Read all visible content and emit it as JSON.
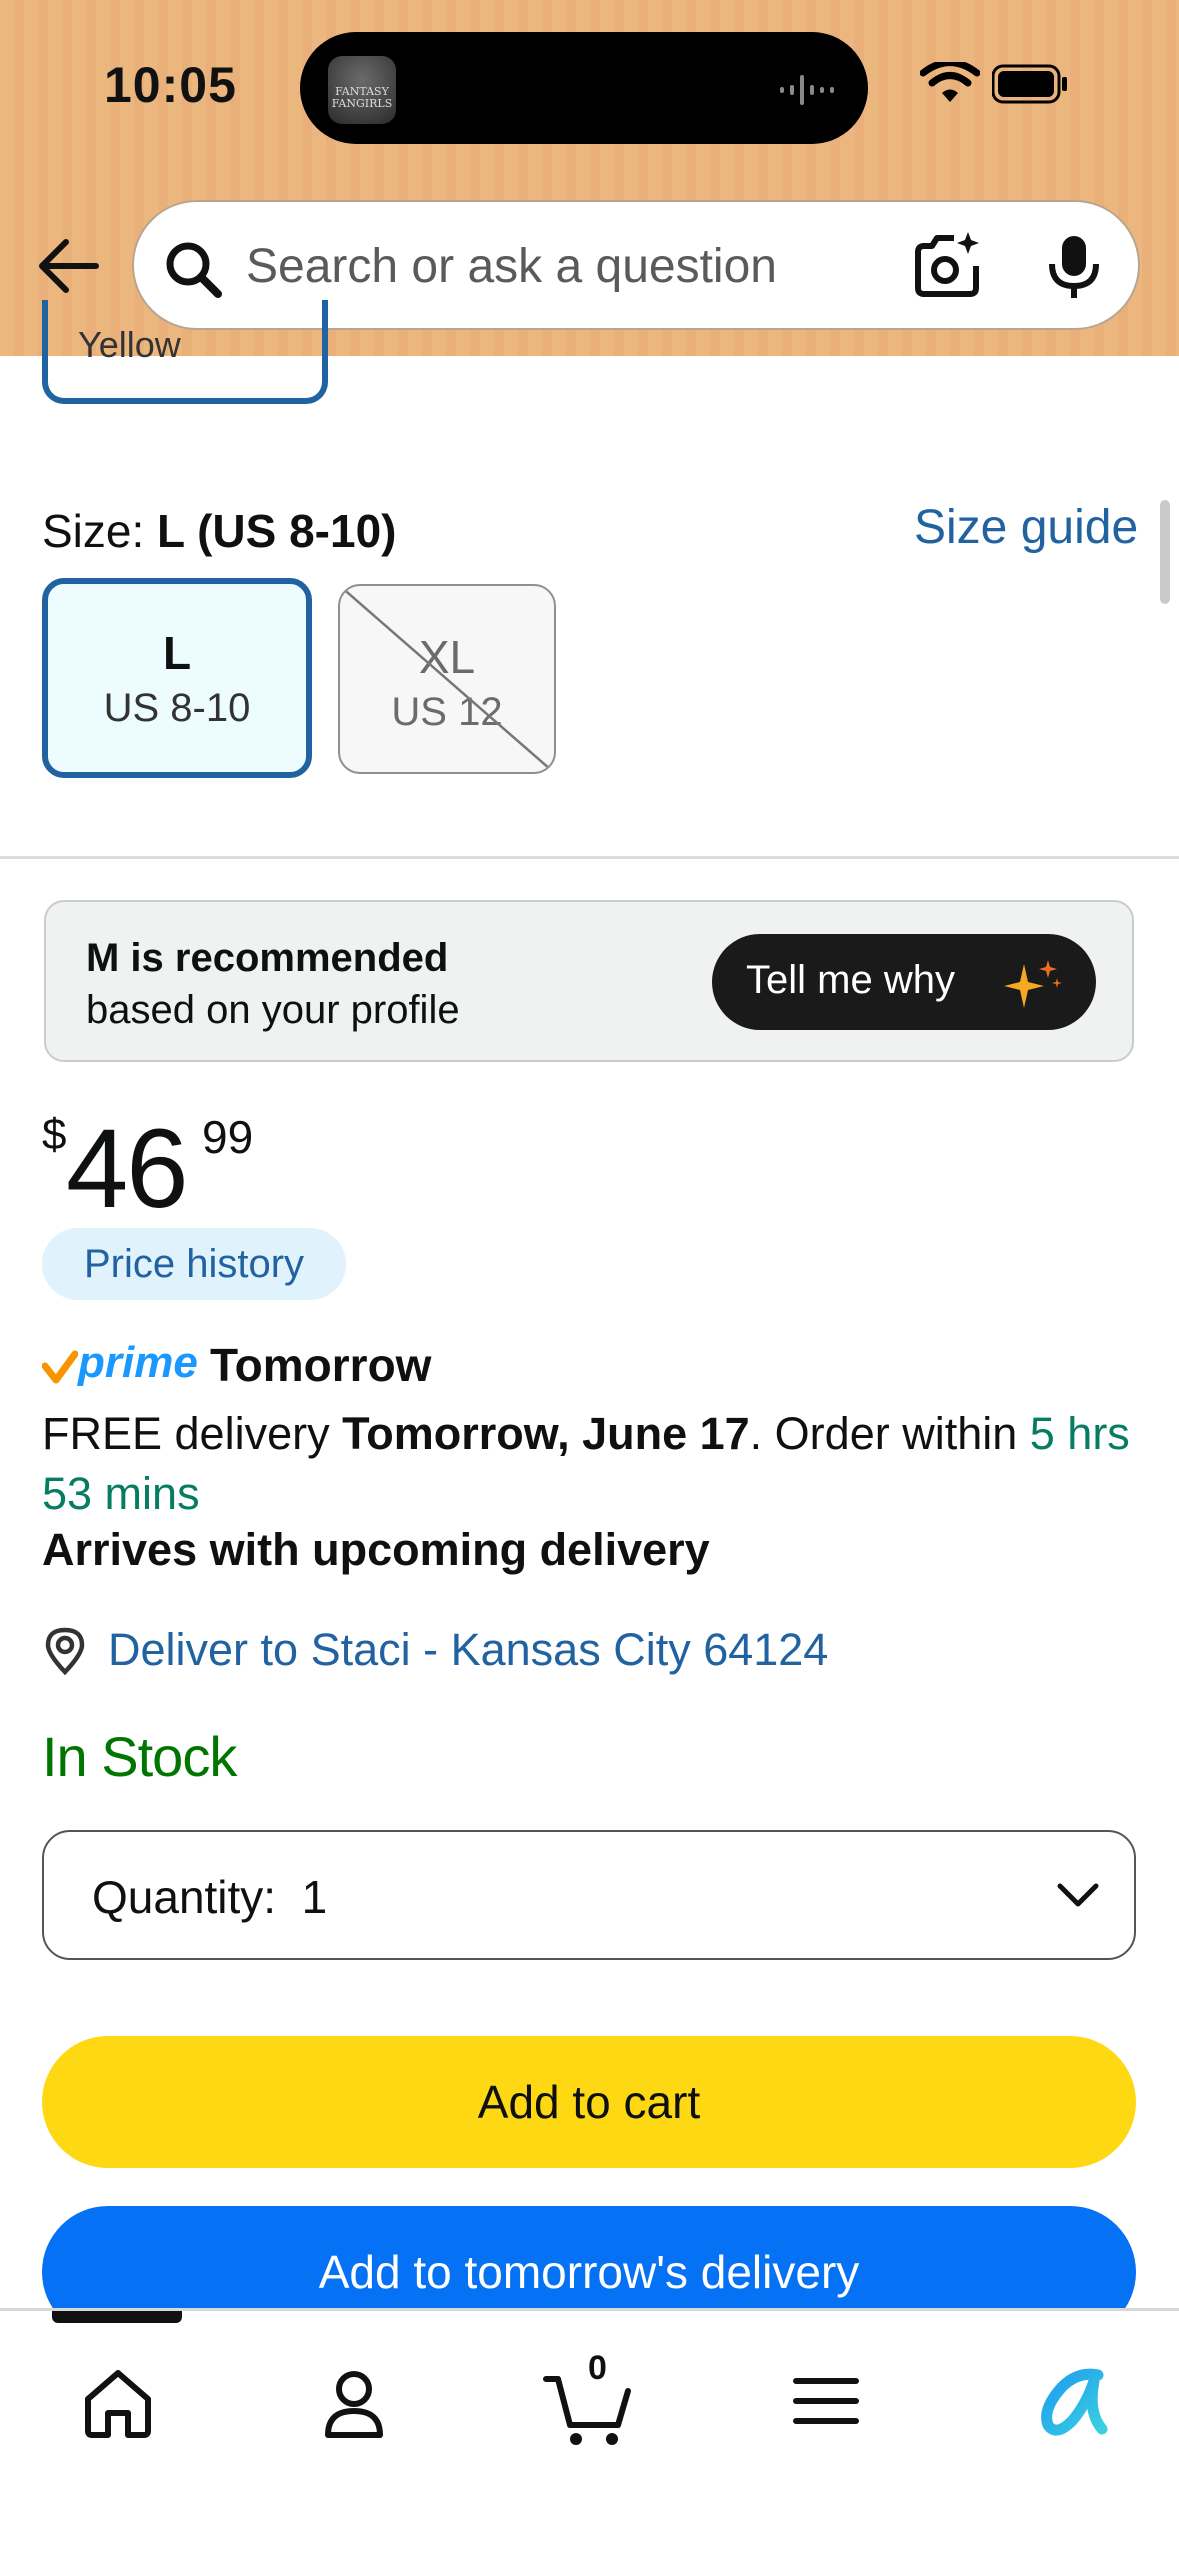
{
  "status_bar": {
    "time": "10:05",
    "island_app_name": "FANTASY FANGIRLS"
  },
  "header": {
    "search_placeholder": "Search or ask a question"
  },
  "previous_swatch": {
    "label": "Yellow"
  },
  "size": {
    "label": "Size: ",
    "selected_value": "L (US 8-10)",
    "guide_link": "Size guide",
    "options": [
      {
        "main": "L",
        "sub": "US 8-10",
        "state": "selected"
      },
      {
        "main": "XL",
        "sub": "US 12",
        "state": "unavailable"
      }
    ]
  },
  "recommendation": {
    "title": "M is recommended",
    "subtitle": "based on your profile",
    "button": "Tell me why"
  },
  "price": {
    "currency": "$",
    "whole": "46",
    "fraction": "99",
    "history_button": "Price history"
  },
  "delivery": {
    "prime_word": "prime",
    "prime_label": "Tomorrow",
    "free_prefix": "FREE delivery ",
    "date": "Tomorrow, June 17",
    "order_within_prefix": ". Order within ",
    "countdown": "5 hrs 53 mins",
    "arrives_note": "Arrives with upcoming delivery",
    "deliver_to": "Deliver to Staci - Kansas City 64124"
  },
  "stock_status": "In Stock",
  "quantity": {
    "label": "Quantity:",
    "value": "1"
  },
  "buttons": {
    "add_to_cart": "Add to cart",
    "add_to_tomorrow": "Add to tomorrow's delivery"
  },
  "bottom_nav": {
    "cart_count": "0",
    "items": [
      "home-icon",
      "account-icon",
      "cart-icon",
      "menu-icon",
      "rufus-icon"
    ]
  },
  "colors": {
    "header_bg": "#ecb67f",
    "link_blue": "#2162a1",
    "in_stock_green": "#007600",
    "countdown_green": "#067d62",
    "cart_yellow": "#ffd814",
    "tomorrow_blue": "#0571f5",
    "prime_blue": "#1a98ff"
  }
}
